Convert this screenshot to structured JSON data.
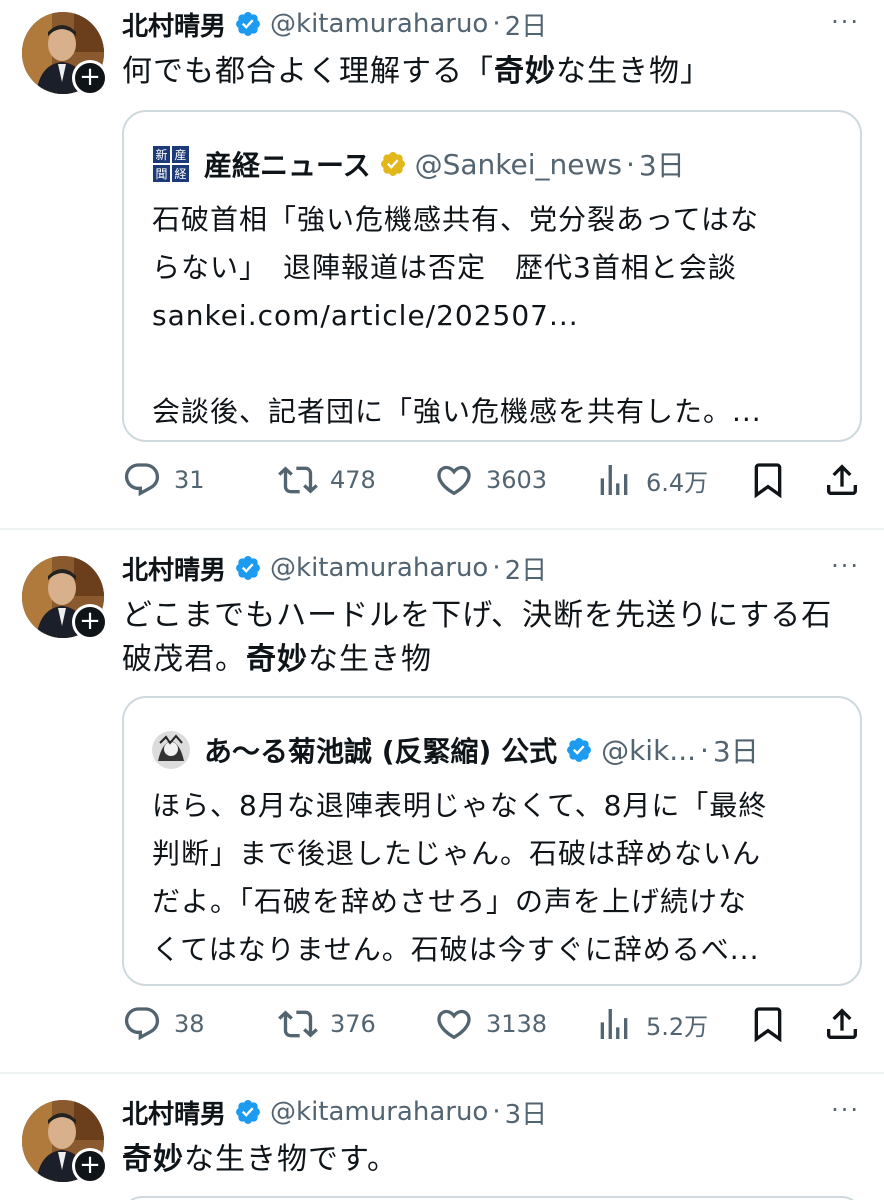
{
  "tweets": [
    {
      "author_name": "北村晴男",
      "handle": "@kitamuraharuo",
      "time": "2日",
      "more": "···",
      "text_plain": "何でも都合よく理解する「",
      "text_bold": "奇妙",
      "text_after": "な生き物」",
      "quote": {
        "name": "産経ニュース",
        "handle": "@Sankei_news",
        "time": "3日",
        "lines": [
          "石破首相「強い危機感共有、党分裂あってはな",
          "らない」　退陣報道は否定　歴代3首相と会談",
          "sankei.com/article/202507...",
          "",
          "会談後、記者団に「強い危機感を共有した。..."
        ]
      },
      "actions": {
        "replies": "31",
        "retweets": "478",
        "likes": "3603",
        "views": "6.4万"
      }
    },
    {
      "author_name": "北村晴男",
      "handle": "@kitamuraharuo",
      "time": "2日",
      "more": "···",
      "text_line1": "どこまでもハードルを下げ、決断を先送りにする石",
      "text_line2_plain": "破茂君。",
      "text_bold": "奇妙",
      "text_after": "な生き物",
      "quote": {
        "name": "あ〜る菊池誠 (反緊縮) 公式",
        "handle": "@kik...",
        "time": "3日",
        "lines": [
          "ほら、8月な退陣表明じゃなくて、8月に「最終",
          "判断」まで後退したじゃん。石破は辞めないん",
          "だよ。「石破を辞めさせろ」の声を上げ続けな",
          "くてはなりません。石破は今すぐに辞めるべ..."
        ]
      },
      "actions": {
        "replies": "38",
        "retweets": "376",
        "likes": "3138",
        "views": "5.2万"
      }
    },
    {
      "author_name": "北村晴男",
      "handle": "@kitamuraharuo",
      "time": "3日",
      "more": "···",
      "text_bold": "奇妙",
      "text_after": "な生き物です。"
    }
  ],
  "icons": {
    "verified": "verified-badge-icon",
    "reply": "reply-icon",
    "retweet": "retweet-icon",
    "like": "heart-icon",
    "views": "views-bar-icon",
    "bookmark": "bookmark-icon",
    "share": "share-icon"
  },
  "colors": {
    "verified_blue": "#1d9bf0",
    "verified_gold": "#e2b719",
    "secondary_text": "#536471",
    "border": "#cfd9de"
  }
}
